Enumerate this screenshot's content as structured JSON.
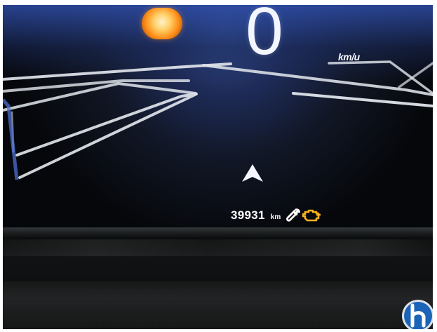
{
  "instrument_cluster": {
    "speed": "0",
    "speed_unit": "km/u",
    "odometer_value": "39931",
    "odometer_unit": "km",
    "warning_icons": [
      "wrench-icon",
      "engine-warning-icon"
    ],
    "navigation_icon": "navigation-arrow-icon"
  },
  "scene": {
    "watermark_logo": "h-logo",
    "colors": {
      "screen_blue": "#2f4a95",
      "line_white": "#dfe4ea",
      "warning_orange": "#ffb21f",
      "dashboard_black": "#151717"
    }
  }
}
